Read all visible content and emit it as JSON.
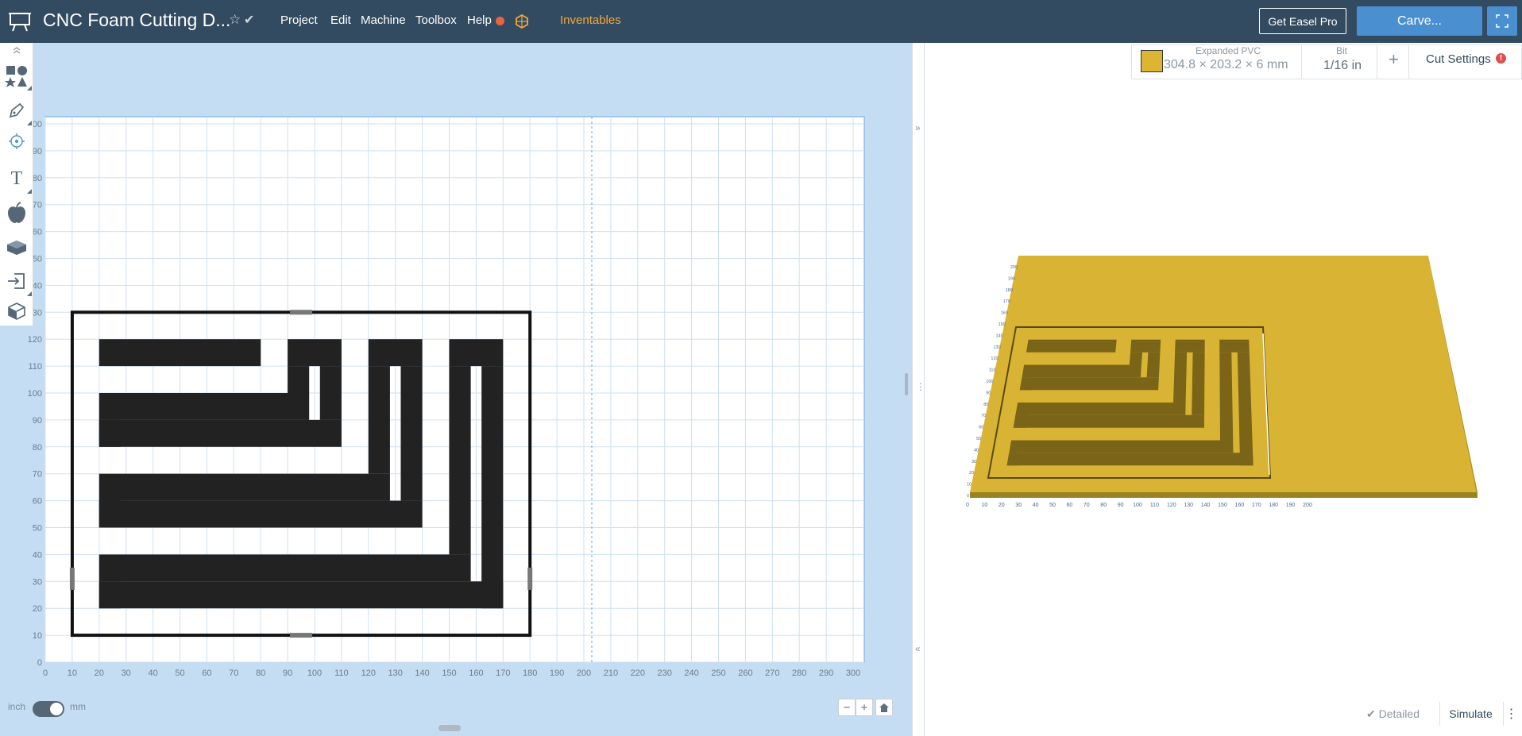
{
  "topbar": {
    "title": "CNC Foam Cutting D...",
    "star_icon": "☆",
    "saved_icon": "✔",
    "menus": [
      "Project",
      "Edit",
      "Machine",
      "Toolbox",
      "Help"
    ],
    "inventables_label": "Inventables",
    "get_pro_label": "Get Easel Pro",
    "carve_label": "Carve..."
  },
  "toolbar": {
    "icons": [
      "collapse-icon",
      "shapes-icon",
      "pen-icon",
      "point-icon",
      "text-icon",
      "apple-icon",
      "bricks-icon",
      "import-icon",
      "3d-box-icon"
    ],
    "text_tool_label": "T",
    "collapse_label": "⌃"
  },
  "canvas": {
    "unit_left": "inch",
    "unit_right": "mm",
    "unit_selected": "mm",
    "x_ticks": [
      "0",
      "10",
      "20",
      "30",
      "40",
      "50",
      "60",
      "70",
      "80",
      "90",
      "100",
      "110",
      "120",
      "130",
      "140",
      "150",
      "160",
      "170",
      "180",
      "190",
      "200",
      "210",
      "220",
      "230",
      "240",
      "250",
      "260",
      "270",
      "280",
      "290",
      "300"
    ],
    "y_ticks": [
      "0",
      "10",
      "20",
      "30",
      "40",
      "50",
      "60",
      "70",
      "80",
      "90",
      "100",
      "110",
      "120"
    ],
    "y_ticks_clipped": [
      "20",
      "30",
      "50",
      "60",
      "80",
      "90",
      "00"
    ],
    "zoom_out": "−",
    "zoom_in": "+",
    "home_icon": "home-icon",
    "panel_collapse_top": "»",
    "panel_collapse_bottom": "«",
    "panel_more": "⋮"
  },
  "material": {
    "name": "Expanded PVC",
    "dimensions": "304.8 × 203.2 × 6 mm",
    "color": "#dcb633"
  },
  "bit": {
    "label": "Bit",
    "value": "1/16 in"
  },
  "add_label": "+",
  "cut_settings": {
    "label": "Cut Settings",
    "alert": "!"
  },
  "preview": {
    "x_ticks": [
      "0",
      "10",
      "20",
      "30",
      "40",
      "50",
      "60",
      "70",
      "80",
      "90",
      "100",
      "110",
      "120",
      "130",
      "140",
      "150",
      "160",
      "170",
      "180",
      "190",
      "200"
    ],
    "y_ticks": [
      "0",
      "10",
      "20",
      "30",
      "40",
      "50",
      "60",
      "70",
      "80",
      "90",
      "100",
      "110",
      "120",
      "130",
      "140",
      "150",
      "160",
      "170",
      "180",
      "190",
      "200"
    ],
    "detailed_label": "Detailed",
    "detailed_icon": "✔",
    "simulate_label": "Simulate",
    "more_icon": "⋮"
  },
  "colors": {
    "topbar": "#334b60",
    "accent": "#4a90d0",
    "canvas_bg": "#c5ddf2",
    "grid": "#d6e6f5",
    "material": "#dcb633",
    "inventables": "#f0a93b",
    "alert": "#e04f4f"
  }
}
